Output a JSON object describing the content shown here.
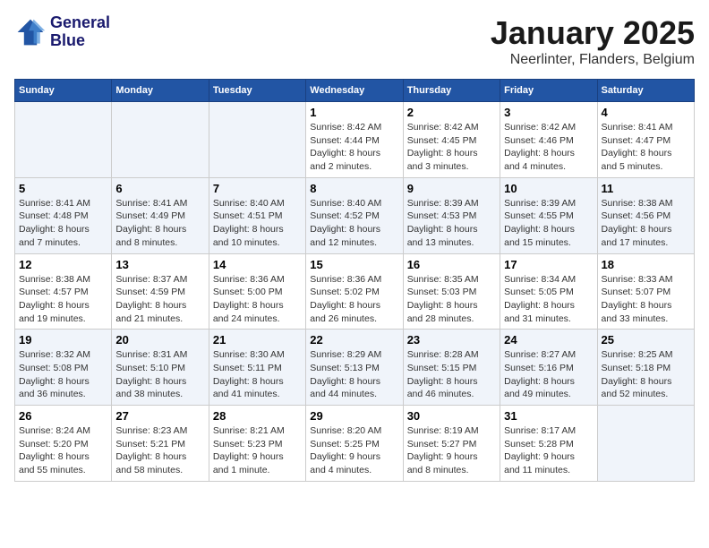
{
  "logo": {
    "line1": "General",
    "line2": "Blue"
  },
  "title": "January 2025",
  "subtitle": "Neerlinter, Flanders, Belgium",
  "weekdays": [
    "Sunday",
    "Monday",
    "Tuesday",
    "Wednesday",
    "Thursday",
    "Friday",
    "Saturday"
  ],
  "weeks": [
    [
      {
        "day": "",
        "info": ""
      },
      {
        "day": "",
        "info": ""
      },
      {
        "day": "",
        "info": ""
      },
      {
        "day": "1",
        "info": "Sunrise: 8:42 AM\nSunset: 4:44 PM\nDaylight: 8 hours\nand 2 minutes."
      },
      {
        "day": "2",
        "info": "Sunrise: 8:42 AM\nSunset: 4:45 PM\nDaylight: 8 hours\nand 3 minutes."
      },
      {
        "day": "3",
        "info": "Sunrise: 8:42 AM\nSunset: 4:46 PM\nDaylight: 8 hours\nand 4 minutes."
      },
      {
        "day": "4",
        "info": "Sunrise: 8:41 AM\nSunset: 4:47 PM\nDaylight: 8 hours\nand 5 minutes."
      }
    ],
    [
      {
        "day": "5",
        "info": "Sunrise: 8:41 AM\nSunset: 4:48 PM\nDaylight: 8 hours\nand 7 minutes."
      },
      {
        "day": "6",
        "info": "Sunrise: 8:41 AM\nSunset: 4:49 PM\nDaylight: 8 hours\nand 8 minutes."
      },
      {
        "day": "7",
        "info": "Sunrise: 8:40 AM\nSunset: 4:51 PM\nDaylight: 8 hours\nand 10 minutes."
      },
      {
        "day": "8",
        "info": "Sunrise: 8:40 AM\nSunset: 4:52 PM\nDaylight: 8 hours\nand 12 minutes."
      },
      {
        "day": "9",
        "info": "Sunrise: 8:39 AM\nSunset: 4:53 PM\nDaylight: 8 hours\nand 13 minutes."
      },
      {
        "day": "10",
        "info": "Sunrise: 8:39 AM\nSunset: 4:55 PM\nDaylight: 8 hours\nand 15 minutes."
      },
      {
        "day": "11",
        "info": "Sunrise: 8:38 AM\nSunset: 4:56 PM\nDaylight: 8 hours\nand 17 minutes."
      }
    ],
    [
      {
        "day": "12",
        "info": "Sunrise: 8:38 AM\nSunset: 4:57 PM\nDaylight: 8 hours\nand 19 minutes."
      },
      {
        "day": "13",
        "info": "Sunrise: 8:37 AM\nSunset: 4:59 PM\nDaylight: 8 hours\nand 21 minutes."
      },
      {
        "day": "14",
        "info": "Sunrise: 8:36 AM\nSunset: 5:00 PM\nDaylight: 8 hours\nand 24 minutes."
      },
      {
        "day": "15",
        "info": "Sunrise: 8:36 AM\nSunset: 5:02 PM\nDaylight: 8 hours\nand 26 minutes."
      },
      {
        "day": "16",
        "info": "Sunrise: 8:35 AM\nSunset: 5:03 PM\nDaylight: 8 hours\nand 28 minutes."
      },
      {
        "day": "17",
        "info": "Sunrise: 8:34 AM\nSunset: 5:05 PM\nDaylight: 8 hours\nand 31 minutes."
      },
      {
        "day": "18",
        "info": "Sunrise: 8:33 AM\nSunset: 5:07 PM\nDaylight: 8 hours\nand 33 minutes."
      }
    ],
    [
      {
        "day": "19",
        "info": "Sunrise: 8:32 AM\nSunset: 5:08 PM\nDaylight: 8 hours\nand 36 minutes."
      },
      {
        "day": "20",
        "info": "Sunrise: 8:31 AM\nSunset: 5:10 PM\nDaylight: 8 hours\nand 38 minutes."
      },
      {
        "day": "21",
        "info": "Sunrise: 8:30 AM\nSunset: 5:11 PM\nDaylight: 8 hours\nand 41 minutes."
      },
      {
        "day": "22",
        "info": "Sunrise: 8:29 AM\nSunset: 5:13 PM\nDaylight: 8 hours\nand 44 minutes."
      },
      {
        "day": "23",
        "info": "Sunrise: 8:28 AM\nSunset: 5:15 PM\nDaylight: 8 hours\nand 46 minutes."
      },
      {
        "day": "24",
        "info": "Sunrise: 8:27 AM\nSunset: 5:16 PM\nDaylight: 8 hours\nand 49 minutes."
      },
      {
        "day": "25",
        "info": "Sunrise: 8:25 AM\nSunset: 5:18 PM\nDaylight: 8 hours\nand 52 minutes."
      }
    ],
    [
      {
        "day": "26",
        "info": "Sunrise: 8:24 AM\nSunset: 5:20 PM\nDaylight: 8 hours\nand 55 minutes."
      },
      {
        "day": "27",
        "info": "Sunrise: 8:23 AM\nSunset: 5:21 PM\nDaylight: 8 hours\nand 58 minutes."
      },
      {
        "day": "28",
        "info": "Sunrise: 8:21 AM\nSunset: 5:23 PM\nDaylight: 9 hours\nand 1 minute."
      },
      {
        "day": "29",
        "info": "Sunrise: 8:20 AM\nSunset: 5:25 PM\nDaylight: 9 hours\nand 4 minutes."
      },
      {
        "day": "30",
        "info": "Sunrise: 8:19 AM\nSunset: 5:27 PM\nDaylight: 9 hours\nand 8 minutes."
      },
      {
        "day": "31",
        "info": "Sunrise: 8:17 AM\nSunset: 5:28 PM\nDaylight: 9 hours\nand 11 minutes."
      },
      {
        "day": "",
        "info": ""
      }
    ]
  ]
}
